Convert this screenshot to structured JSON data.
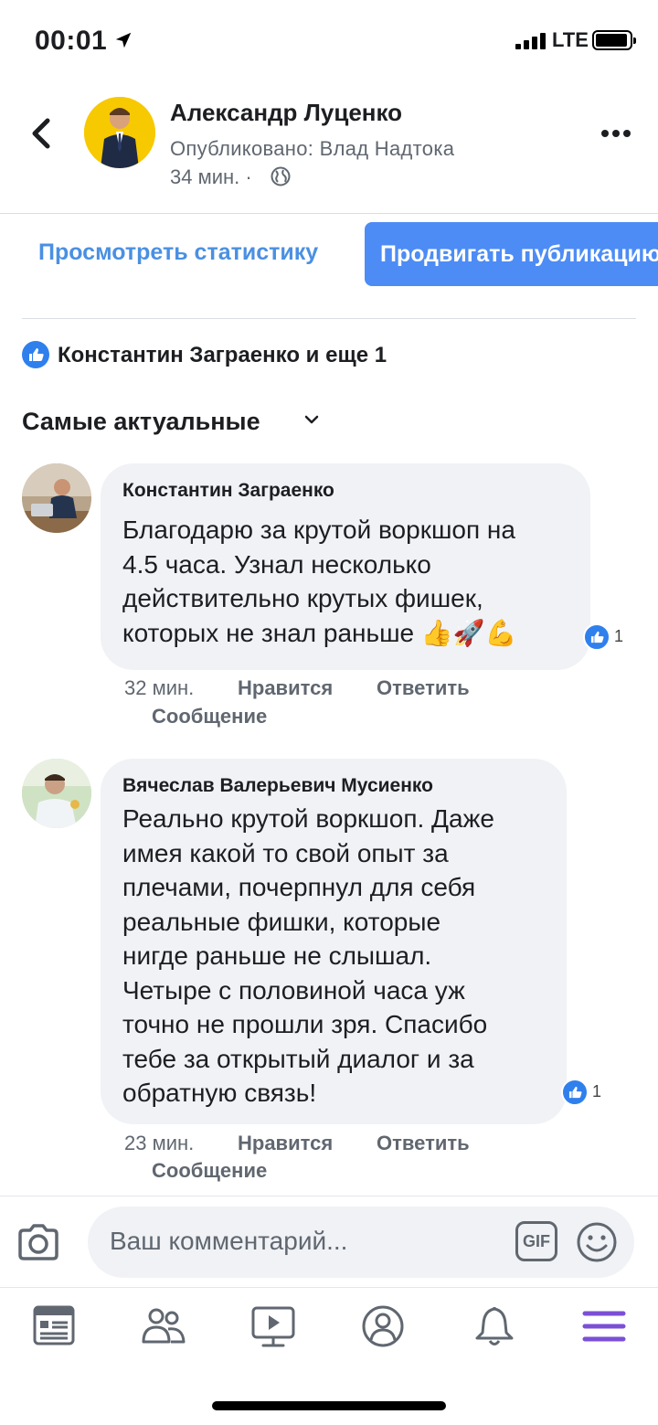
{
  "status_bar": {
    "time": "00:01",
    "network": "LTE"
  },
  "header": {
    "author": "Александр Луценко",
    "published_by": "Опубликовано: Влад Надтока",
    "timestamp": "34 мин. ·",
    "icons": [
      "back-arrow-icon",
      "globe-icon",
      "more-options-icon"
    ]
  },
  "actions": {
    "view_stats": "Просмотреть статистику",
    "promote": "Продвигать публикацию"
  },
  "reactions": {
    "summary": "Константин Заграенко и еще 1"
  },
  "sort": {
    "label": "Самые актуальные"
  },
  "comments": [
    {
      "author": "Константин Заграенко",
      "text": "Благодарю за крутой воркшоп на\n4.5 часа. Узнал несколько\nдействительно крутых фишек,\nкоторых не знал раньше 👍🚀💪",
      "likes": "1",
      "time": "32 мин.",
      "like_label": "Нравится",
      "reply_label": "Ответить",
      "message_label": "Сообщение"
    },
    {
      "author": "Вячеслав Валерьевич Мусиенко",
      "text": "Реально крутой воркшоп. Даже\nимея какой то свой опыт за\nплечами, почерпнул для себя\nреальные фишки, которые\nнигде раньше не слышал.\nЧетыре с половиной часа уж\nточно не прошли зря. Спасибо\nтебе за открытый диалог и за\nобратную связь!",
      "likes": "1",
      "time": "23 мин.",
      "like_label": "Нравится",
      "reply_label": "Ответить",
      "message_label": "Сообщение"
    }
  ],
  "composer": {
    "placeholder": "Ваш комментарий...",
    "gif": "GIF"
  },
  "colors": {
    "accent": "#4d8cf5",
    "link": "#4a90e2",
    "like": "#2f80ed",
    "menu_active": "#7b4fd6"
  }
}
